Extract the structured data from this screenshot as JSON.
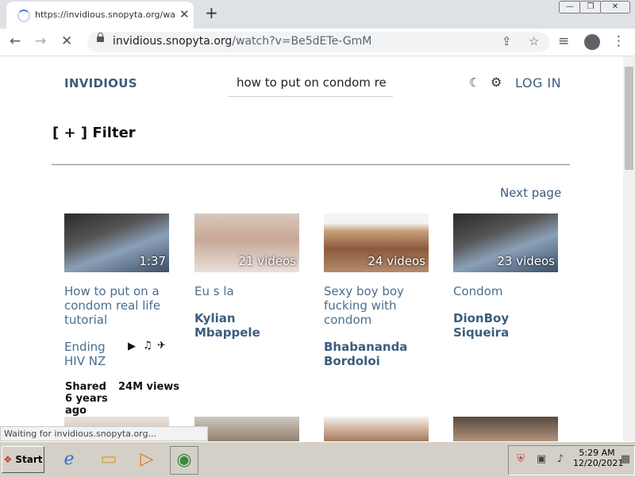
{
  "browser": {
    "tab_title": "https://invidious.snopyta.org/watch",
    "url_host": "invidious.snopyta.org",
    "url_path": "/watch?v=Be5dETe-GmM"
  },
  "page": {
    "brand": "INVIDIOUS",
    "search_value": "how to put on condom re",
    "login": "LOG IN",
    "filter": "[ + ] Filter",
    "next_page": "Next page",
    "videos": [
      {
        "thumb_label": "1:37",
        "title": "How to put on a condom real life tutorial",
        "author": "Ending HIV NZ",
        "shared": "Shared 6 years ago",
        "views": "24M views"
      },
      {
        "thumb_label": "21 videos",
        "title": "Eu s la",
        "author": "Kylian Mbappele"
      },
      {
        "thumb_label": "24 videos",
        "title": "Sexy boy boy fucking with condom",
        "author": "Bhabananda Bordoloi"
      },
      {
        "thumb_label": "23 videos",
        "title": "Condom",
        "author": "DionBoy Siqueira"
      }
    ]
  },
  "status_text": "Waiting for invidious.snopyta.org...",
  "taskbar": {
    "start": "Start",
    "time": "5:29 AM",
    "date": "12/20/2021"
  },
  "colors": {
    "link": "#3b5d7e",
    "title": "#4a6e8f"
  }
}
